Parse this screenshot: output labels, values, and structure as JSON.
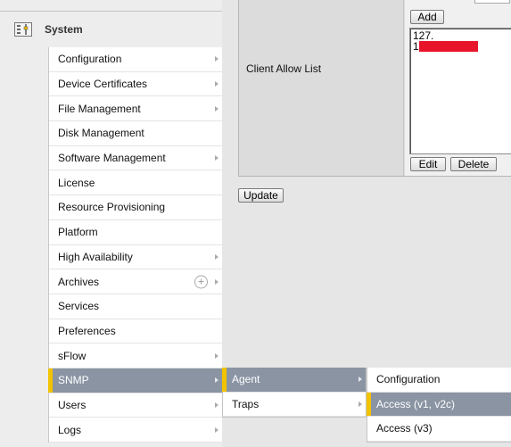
{
  "system": {
    "title": "System",
    "icon": "system-icon"
  },
  "menu": {
    "items": [
      {
        "label": "Configuration",
        "arrow": true
      },
      {
        "label": "Device Certificates",
        "arrow": true
      },
      {
        "label": "File Management",
        "arrow": true
      },
      {
        "label": "Disk Management",
        "arrow": false
      },
      {
        "label": "Software Management",
        "arrow": true
      },
      {
        "label": "License",
        "arrow": false
      },
      {
        "label": "Resource Provisioning",
        "arrow": false
      },
      {
        "label": "Platform",
        "arrow": false
      },
      {
        "label": "High Availability",
        "arrow": true
      },
      {
        "label": "Archives",
        "arrow": true,
        "add_icon": "+"
      },
      {
        "label": "Services",
        "arrow": false
      },
      {
        "label": "Preferences",
        "arrow": false
      },
      {
        "label": "sFlow",
        "arrow": true
      },
      {
        "label": "SNMP",
        "arrow": true,
        "active": true
      },
      {
        "label": "Users",
        "arrow": true
      },
      {
        "label": "Logs",
        "arrow": true
      }
    ]
  },
  "snmp_submenu": {
    "items": [
      {
        "label": "Agent",
        "arrow": true,
        "active": true
      },
      {
        "label": "Traps",
        "arrow": true
      }
    ]
  },
  "agent_submenu": {
    "items": [
      {
        "label": "Configuration",
        "active": false
      },
      {
        "label": "Access (v1, v2c)",
        "active": true
      },
      {
        "label": "Access (v3)",
        "active": false
      }
    ]
  },
  "panel": {
    "client_allow_label": "Client Allow List",
    "add_label": "Add",
    "allow_list": [
      "127.",
      "1"
    ],
    "edit_label": "Edit",
    "delete_label": "Delete"
  },
  "update_label": "Update",
  "colors": {
    "active_bg": "#8a94a3",
    "active_marker": "#f2c300",
    "redaction": "#e8152a"
  }
}
